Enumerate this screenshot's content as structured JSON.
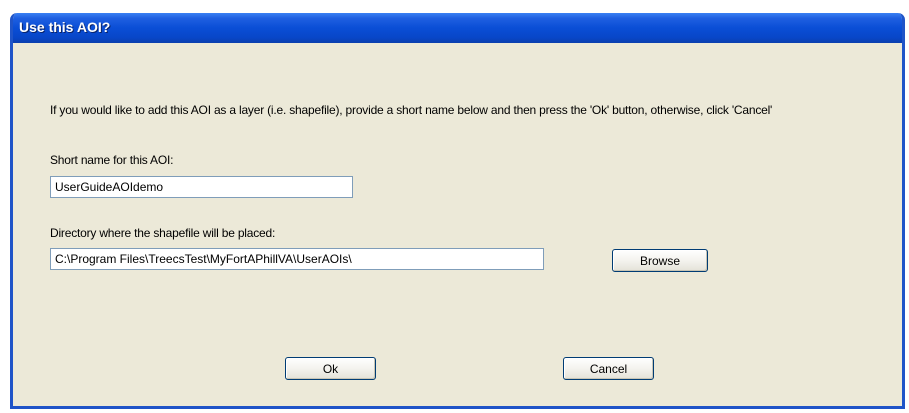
{
  "window": {
    "title": "Use this AOI?"
  },
  "dialog": {
    "instructions": "If you would like to add this AOI as a layer (i.e. shapefile), provide a short name below and then press the 'Ok' button, otherwise, click 'Cancel'",
    "short_name_label": "Short name for this AOI:",
    "short_name_value": "UserGuideAOIdemo",
    "directory_label": "Directory where the shapefile will be placed:",
    "directory_value": "C:\\Program Files\\TreecsTest\\MyFortAPhillVA\\UserAOIs\\",
    "browse_label": "Browse",
    "ok_label": "Ok",
    "cancel_label": "Cancel"
  }
}
